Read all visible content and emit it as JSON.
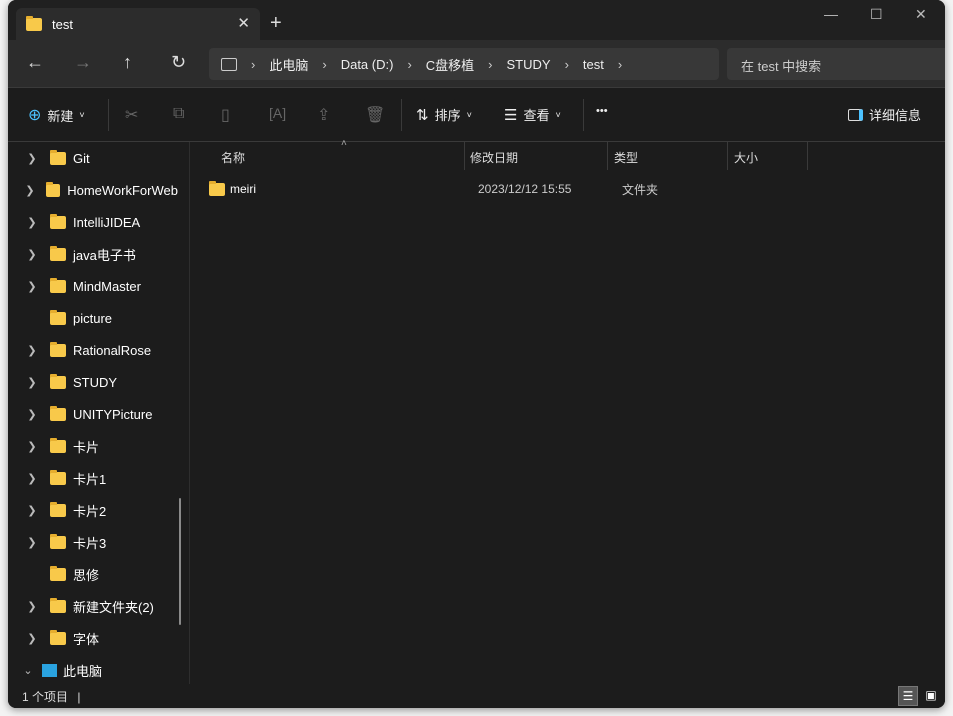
{
  "tab": {
    "title": "test",
    "close": "✕",
    "new": "+"
  },
  "window_controls": {
    "minimize": "—",
    "maximize": "☐",
    "close": "✕"
  },
  "nav": {
    "back": "←",
    "forward": "→",
    "up": "↑",
    "refresh": "↻"
  },
  "breadcrumb": [
    "此电脑",
    "Data (D:)",
    "C盘移植",
    "STUDY",
    "test"
  ],
  "search": {
    "placeholder": "在 test 中搜索"
  },
  "toolbar": {
    "new": "新建",
    "sort": "排序",
    "view": "查看",
    "more": "•••",
    "details": "详细信息"
  },
  "sidebar": {
    "items": [
      {
        "label": "Git",
        "chev": true
      },
      {
        "label": "HomeWorkForWeb",
        "chev": true
      },
      {
        "label": "IntelliJIDEA",
        "chev": true
      },
      {
        "label": "java电子书",
        "chev": true
      },
      {
        "label": "MindMaster",
        "chev": true
      },
      {
        "label": "picture",
        "chev": false
      },
      {
        "label": "RationalRose",
        "chev": true
      },
      {
        "label": "STUDY",
        "chev": true
      },
      {
        "label": "UNITYPicture",
        "chev": true
      },
      {
        "label": "卡片",
        "chev": true
      },
      {
        "label": "卡片1",
        "chev": true
      },
      {
        "label": "卡片2",
        "chev": true
      },
      {
        "label": "卡片3",
        "chev": true
      },
      {
        "label": "思修",
        "chev": false
      },
      {
        "label": "新建文件夹(2)",
        "chev": true
      },
      {
        "label": "字体",
        "chev": true
      }
    ],
    "this_pc": "此电脑"
  },
  "columns": {
    "name": "名称",
    "modified": "修改日期",
    "type": "类型",
    "size": "大小"
  },
  "files": [
    {
      "name": "meiri",
      "modified": "2023/12/12 15:55",
      "type": "文件夹",
      "size": ""
    }
  ],
  "status": {
    "count": "1 个项目"
  }
}
